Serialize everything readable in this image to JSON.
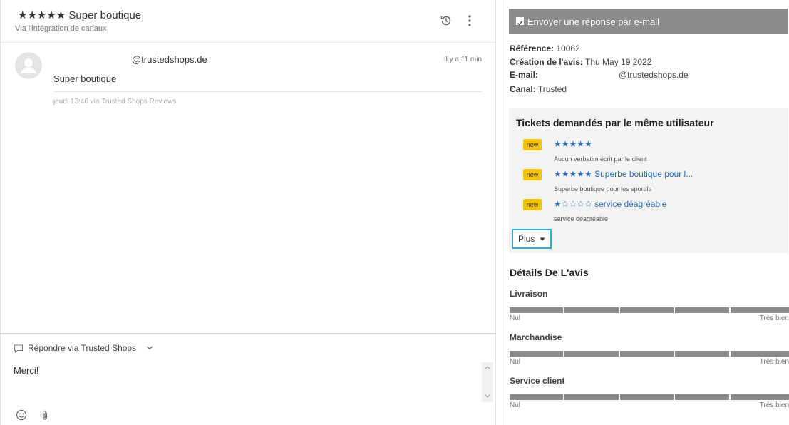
{
  "header": {
    "title": "★★★★★ Super boutique",
    "subtitle": "Via l'intégration de canaux"
  },
  "message": {
    "sender": "@trustedshops.de",
    "time": "Il y a 11 min",
    "body": "Super boutique",
    "meta": "jeudi 13:46 via Trusted Shops Reviews"
  },
  "reply": {
    "label": "Répondre via Trusted Shops",
    "text": "Merci!"
  },
  "side": {
    "email_toggle": "Envoyer une réponse par e-mail",
    "info": {
      "reference_label": "Référence:",
      "reference_value": "10062",
      "creation_label": "Création de l'avis:",
      "creation_value": "Thu May 19 2022",
      "email_label": "E-mail:",
      "email_value": "@trustedshops.de",
      "canal_label": "Canal:",
      "canal_value": "Trusted"
    },
    "tickets": {
      "title": "Tickets demandés par le même utilisateur",
      "items": [
        {
          "badge": "new",
          "title": "★★★★★",
          "subtitle": "Aucun verbatim écrit par le client"
        },
        {
          "badge": "new",
          "title": "★★★★★ Superbe boutique pour l...",
          "subtitle": "Superbe boutique pour les sportifs"
        },
        {
          "badge": "new",
          "title": "★☆☆☆☆ service déagréable",
          "subtitle": "service déagréable"
        }
      ],
      "more": "Plus"
    },
    "details": {
      "title": "Détails De L'avis",
      "criteria": [
        {
          "name": "Livraison",
          "low": "Nul",
          "high": "Très bien"
        },
        {
          "name": "Marchandise",
          "low": "Nul",
          "high": "Très bien"
        },
        {
          "name": "Service client",
          "low": "Nul",
          "high": "Très bien"
        }
      ]
    }
  },
  "colors": {
    "accent_link": "#2a6db3",
    "badge": "#f5c400",
    "toggle_bg": "#8c8c8c",
    "focus_ring": "#2fb0d3"
  }
}
